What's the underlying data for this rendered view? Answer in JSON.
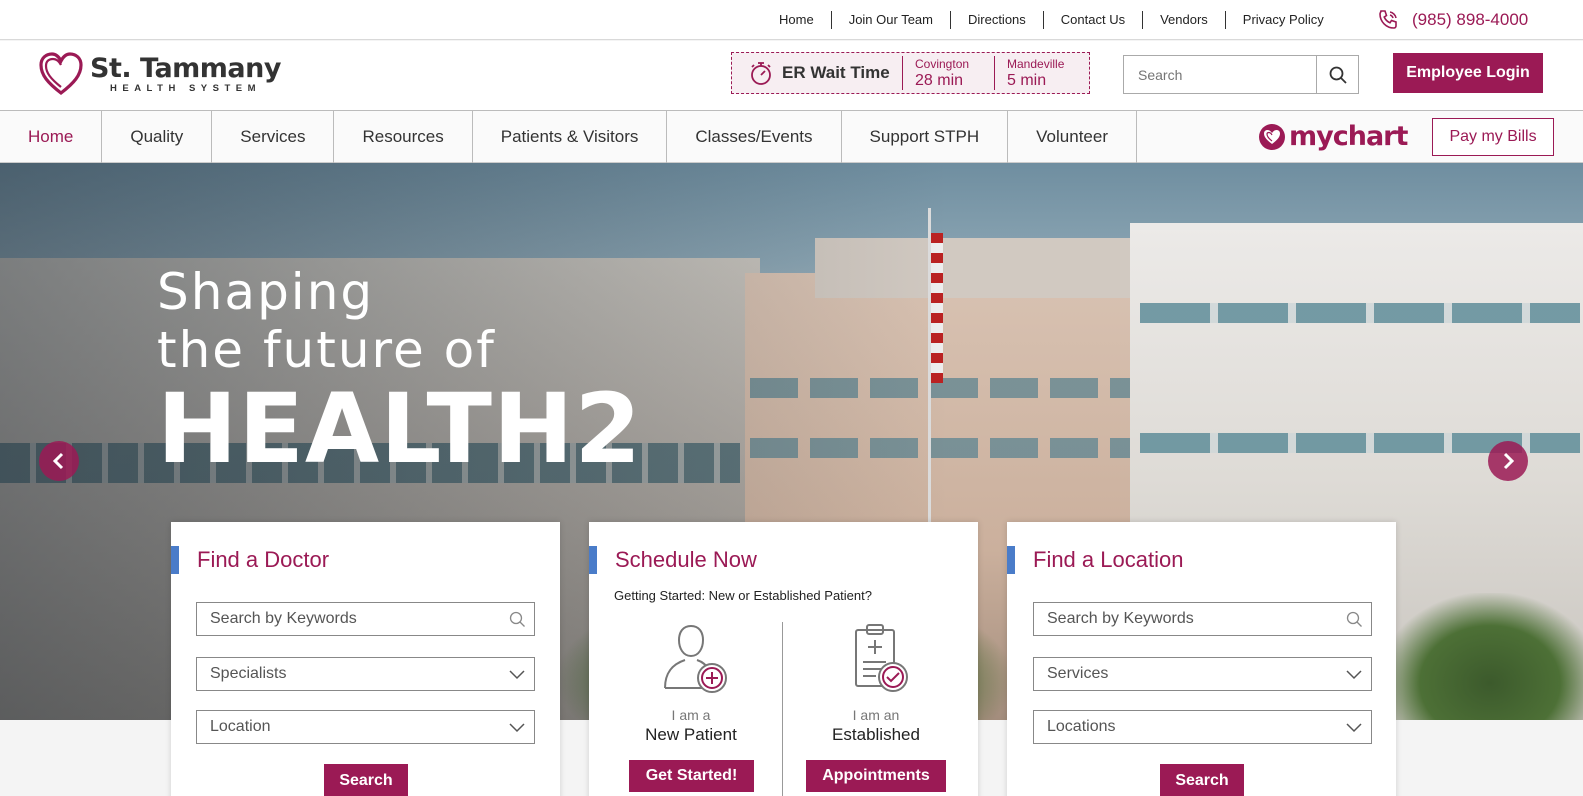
{
  "topbar": {
    "links": [
      "Home",
      "Join Our Team",
      "Directions",
      "Contact Us",
      "Vendors",
      "Privacy Policy"
    ],
    "phone": "(985) 898-4000"
  },
  "header": {
    "logo_name": "St. Tammany",
    "logo_sub": "HEALTH SYSTEM",
    "er_wait": {
      "title": "ER Wait Time",
      "locations": [
        {
          "name": "Covington",
          "time": "28 min"
        },
        {
          "name": "Mandeville",
          "time": "5 min"
        }
      ]
    },
    "search_placeholder": "Search",
    "employee_login": "Employee Login"
  },
  "nav": {
    "items": [
      "Home",
      "Quality",
      "Services",
      "Resources",
      "Patients & Visitors",
      "Classes/Events",
      "Support STPH",
      "Volunteer"
    ],
    "active": "Home",
    "mychart": "mychart",
    "pay_bills": "Pay my Bills"
  },
  "hero": {
    "line1": "Shaping",
    "line2": "the future of",
    "line3": "HEALTH2"
  },
  "find_doctor": {
    "title": "Find a Doctor",
    "search_placeholder": "Search by Keywords",
    "select1": "Specialists",
    "select2": "Location",
    "button": "Search"
  },
  "schedule": {
    "title": "Schedule Now",
    "subtitle": "Getting Started: New or Established Patient?",
    "new": {
      "iam": "I am a",
      "type": "New Patient",
      "button": "Get Started!"
    },
    "established": {
      "iam": "I am an",
      "type": "Established",
      "button": "Appointments"
    }
  },
  "find_location": {
    "title": "Find a Location",
    "search_placeholder": "Search by Keywords",
    "select1": "Services",
    "select2": "Locations",
    "button": "Search"
  },
  "colors": {
    "brand": "#9b1a55",
    "accent": "#4a7cc9"
  }
}
